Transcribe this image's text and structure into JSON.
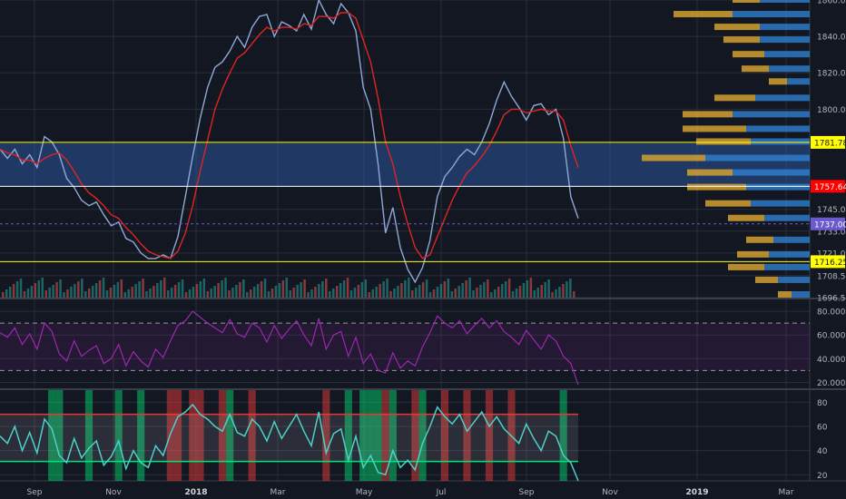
{
  "colors": {
    "background": "#131722",
    "grid": "#2a2e39",
    "axis_text": "#b2b5be",
    "price_line": "#8fa8d8",
    "ma_line": "#e02424",
    "zone_fill": "#2e62b5",
    "zone_line": "#ffff00",
    "resistance_label": "#ff0000",
    "last_price_label": "#6a5acd",
    "rsi_line": "#9c27b0",
    "osc_line": "#4dd0c8",
    "osc_band_upper": "#e53935",
    "osc_band_lower": "#00e676",
    "vp_value_area": "#2f7fd0",
    "vp_gold": "#d4a030",
    "vp_gray": "#9aa0a8"
  },
  "chart_data": [
    {
      "type": "line",
      "name": "price",
      "xlabels": [
        "Sep",
        "Nov",
        "2018",
        "Mar",
        "May",
        "Jul",
        "Sep",
        "Nov",
        "2019",
        "Mar"
      ],
      "y_ticks": [
        1860.0,
        1840.0,
        1820.0,
        1800.0,
        1745.0,
        1733.0,
        1721.0,
        1708.5,
        1696.5
      ],
      "ylim": [
        1696.5,
        1860.0
      ],
      "price_labels": [
        {
          "value": "1781.78",
          "style": "yellow"
        },
        {
          "value": "1757.64",
          "style": "red"
        },
        {
          "value": "1737.00",
          "style": "purple"
        },
        {
          "value": "1716.25",
          "style": "yellow"
        }
      ],
      "horizontal_levels": [
        1781.78,
        1757.64,
        1737.0,
        1716.25
      ],
      "zone": [
        1757.64,
        1781.78
      ],
      "series": [
        {
          "values": [
            1778,
            1773,
            1778,
            1770,
            1775,
            1768,
            1785,
            1782,
            1775,
            1762,
            1757,
            1750,
            1747,
            1749,
            1742,
            1736,
            1738,
            1729,
            1727,
            1721,
            1718,
            1718,
            1720,
            1718,
            1730,
            1752,
            1774,
            1795,
            1812,
            1823,
            1826,
            1832,
            1840,
            1834,
            1845,
            1851,
            1852,
            1840,
            1848,
            1846,
            1843,
            1852,
            1844,
            1860,
            1852,
            1847,
            1858,
            1853,
            1843,
            1812,
            1800,
            1770,
            1732,
            1746,
            1724,
            1712,
            1705,
            1713,
            1728,
            1752,
            1763,
            1768,
            1774,
            1778,
            1775,
            1782,
            1792,
            1805,
            1815,
            1807,
            1801,
            1794,
            1802,
            1803,
            1797,
            1800,
            1784,
            1752,
            1740
          ]
        },
        {
          "values": [
            1778,
            1776,
            1775,
            1772,
            1772,
            1770,
            1773,
            1775,
            1776,
            1772,
            1766,
            1759,
            1754,
            1751,
            1747,
            1742,
            1740,
            1735,
            1731,
            1726,
            1722,
            1720,
            1719,
            1718,
            1722,
            1732,
            1747,
            1766,
            1783,
            1800,
            1811,
            1820,
            1828,
            1831,
            1836,
            1841,
            1845,
            1843,
            1845,
            1845,
            1844,
            1847,
            1846,
            1851,
            1851,
            1850,
            1853,
            1853,
            1850,
            1838,
            1826,
            1806,
            1782,
            1770,
            1752,
            1737,
            1724,
            1718,
            1720,
            1730,
            1740,
            1750,
            1758,
            1765,
            1769,
            1774,
            1780,
            1788,
            1797,
            1800,
            1800,
            1798,
            1799,
            1800,
            1799,
            1799,
            1794,
            1780,
            1768
          ]
        }
      ],
      "volume_profile": [
        {
          "price": 1866,
          "value_area": 20,
          "gold": 15
        },
        {
          "price": 1860,
          "value_area": 55,
          "gold": 30
        },
        {
          "price": 1852,
          "value_area": 85,
          "gold": 65
        },
        {
          "price": 1845,
          "value_area": 55,
          "gold": 50
        },
        {
          "price": 1838,
          "value_area": 55,
          "gold": 40
        },
        {
          "price": 1830,
          "value_area": 50,
          "gold": 35
        },
        {
          "price": 1822,
          "value_area": 45,
          "gold": 30
        },
        {
          "price": 1815,
          "value_area": 25,
          "gold": 20
        },
        {
          "price": 1806,
          "value_area": 60,
          "gold": 45
        },
        {
          "price": 1797,
          "value_area": 85,
          "gold": 55
        },
        {
          "price": 1789,
          "value_area": 70,
          "gold": 70
        },
        {
          "price": 1782,
          "value_area": 65,
          "gold": 60
        },
        {
          "price": 1773,
          "value_area": 115,
          "gold": 70
        },
        {
          "price": 1765,
          "value_area": 85,
          "gold": 50
        },
        {
          "price": 1757,
          "value_area": 70,
          "gold": 65
        },
        {
          "price": 1748,
          "value_area": 65,
          "gold": 50
        },
        {
          "price": 1740,
          "value_area": 50,
          "gold": 40
        },
        {
          "price": 1728,
          "value_area": 40,
          "gold": 30
        },
        {
          "price": 1720,
          "value_area": 45,
          "gold": 35
        },
        {
          "price": 1713,
          "value_area": 50,
          "gold": 40
        },
        {
          "price": 1706,
          "value_area": 35,
          "gold": 25
        },
        {
          "price": 1698,
          "value_area": 20,
          "gold": 15
        }
      ]
    },
    {
      "type": "line",
      "name": "RSI",
      "y_ticks": [
        "80.0000",
        "60.0000",
        "40.0000",
        "20.0000"
      ],
      "ylim": [
        15,
        90
      ],
      "levels": [
        70,
        30
      ],
      "series": [
        {
          "values": [
            62,
            58,
            66,
            52,
            61,
            48,
            70,
            63,
            44,
            38,
            55,
            42,
            47,
            51,
            36,
            40,
            52,
            34,
            46,
            38,
            33,
            48,
            41,
            55,
            68,
            72,
            80,
            75,
            70,
            66,
            62,
            73,
            61,
            58,
            70,
            66,
            54,
            68,
            57,
            65,
            72,
            60,
            51,
            74,
            48,
            60,
            63,
            42,
            58,
            36,
            44,
            30,
            28,
            45,
            32,
            38,
            34,
            50,
            62,
            76,
            70,
            66,
            72,
            61,
            68,
            74,
            66,
            72,
            63,
            58,
            52,
            64,
            56,
            48,
            60,
            55,
            42,
            36,
            18
          ]
        }
      ]
    },
    {
      "type": "line",
      "name": "oscillator",
      "y_ticks": [
        "80",
        "60",
        "40",
        "20"
      ],
      "ylim": [
        15,
        90
      ],
      "bands": [
        70,
        31
      ],
      "series": [
        {
          "values": [
            52,
            46,
            60,
            40,
            55,
            38,
            66,
            58,
            36,
            30,
            50,
            34,
            42,
            48,
            28,
            35,
            48,
            25,
            40,
            30,
            26,
            44,
            36,
            54,
            68,
            72,
            78,
            70,
            66,
            60,
            56,
            70,
            55,
            52,
            66,
            60,
            48,
            64,
            50,
            60,
            70,
            56,
            44,
            72,
            38,
            54,
            58,
            32,
            52,
            26,
            36,
            22,
            20,
            40,
            26,
            32,
            24,
            46,
            60,
            76,
            68,
            62,
            70,
            56,
            64,
            72,
            60,
            68,
            58,
            52,
            46,
            62,
            50,
            40,
            56,
            52,
            36,
            30,
            15
          ]
        }
      ],
      "overbought_columns": [
        23,
        24,
        26,
        27,
        30,
        34,
        44,
        52,
        56,
        60,
        63,
        66,
        69
      ],
      "oversold_columns": [
        7,
        8,
        12,
        16,
        19,
        31,
        47,
        49,
        50,
        51,
        53,
        57,
        76
      ]
    }
  ]
}
